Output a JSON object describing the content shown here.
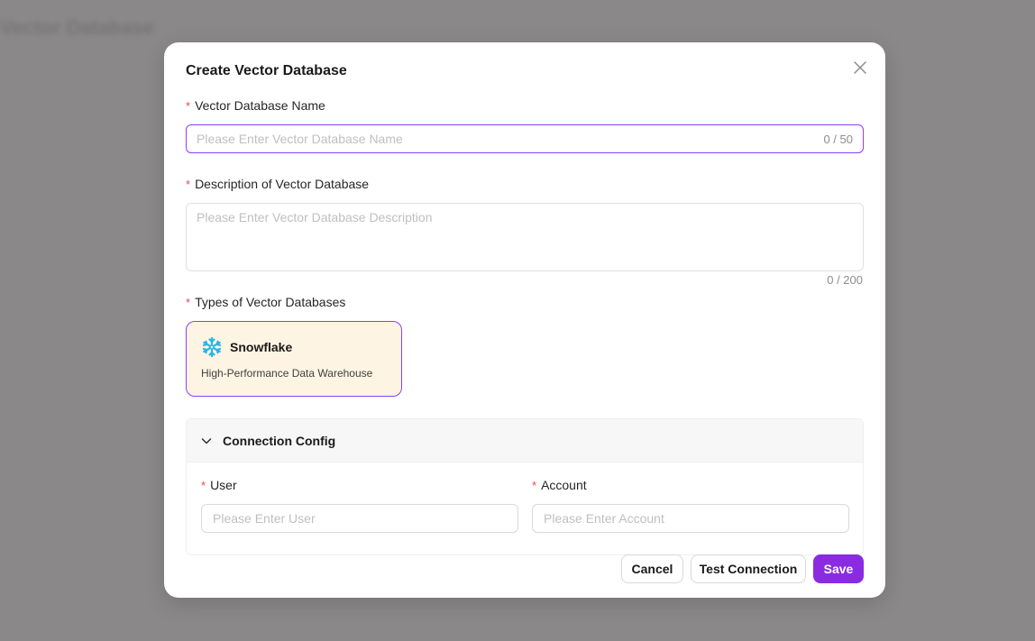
{
  "background": {
    "title": "Vector Database"
  },
  "modal": {
    "title": "Create Vector Database",
    "name_field": {
      "label": "Vector Database Name",
      "placeholder": "Please Enter Vector Database Name",
      "value": "",
      "counter": "0 / 50"
    },
    "description_field": {
      "label": "Description of Vector Database",
      "placeholder": "Please Enter Vector Database Description",
      "value": "",
      "counter": "0 / 200"
    },
    "types": {
      "label": "Types of Vector Databases",
      "options": [
        {
          "name": "Snowflake",
          "description": "High-Performance Data Warehouse",
          "icon": "snowflake-icon",
          "selected": true
        }
      ]
    },
    "connection_config": {
      "title": "Connection Config",
      "expanded": true,
      "user": {
        "label": "User",
        "placeholder": "Please Enter User"
      },
      "account": {
        "label": "Account",
        "placeholder": "Please Enter Account"
      }
    },
    "buttons": {
      "cancel": "Cancel",
      "test_connection": "Test Connection",
      "save": "Save"
    }
  },
  "colors": {
    "accent": "#8a2be2",
    "required": "#e5484d",
    "snowflake_blue": "#29b5e8",
    "card_bg": "#fdf4e3"
  }
}
